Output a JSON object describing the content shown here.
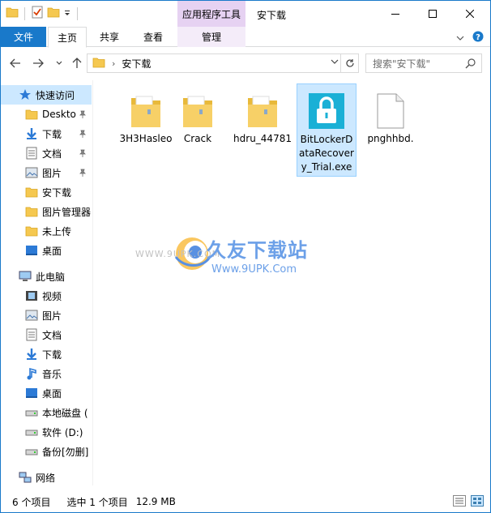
{
  "titlebar": {
    "context_tab": "应用程序工具",
    "title": "安下载",
    "minimize": "—",
    "maximize": "☐",
    "close": "✕"
  },
  "ribbon": {
    "tabs": [
      {
        "label": "文件"
      },
      {
        "label": "主页"
      },
      {
        "label": "共享"
      },
      {
        "label": "查看"
      },
      {
        "label": "管理"
      }
    ]
  },
  "address": {
    "path": "安下载",
    "search_placeholder": "搜索\"安下载\""
  },
  "nav": {
    "items": [
      {
        "label": "快速访问",
        "icon": "star-icon",
        "pinned": false
      },
      {
        "label": "Deskto",
        "icon": "folder-icon",
        "pinned": true
      },
      {
        "label": "下载",
        "icon": "download-icon",
        "pinned": true
      },
      {
        "label": "文档",
        "icon": "document-icon",
        "pinned": true
      },
      {
        "label": "图片",
        "icon": "picture-icon",
        "pinned": true
      },
      {
        "label": "安下载",
        "icon": "folder-icon",
        "pinned": false
      },
      {
        "label": "图片管理器",
        "icon": "folder-icon",
        "pinned": false
      },
      {
        "label": "未上传",
        "icon": "folder-icon",
        "pinned": false
      },
      {
        "label": "桌面",
        "icon": "desktop-icon",
        "pinned": false
      },
      {
        "label": "此电脑",
        "icon": "computer-icon",
        "pinned": false
      },
      {
        "label": "视频",
        "icon": "video-icon",
        "pinned": false
      },
      {
        "label": "图片",
        "icon": "picture-icon",
        "pinned": false
      },
      {
        "label": "文档",
        "icon": "document-icon",
        "pinned": false
      },
      {
        "label": "下载",
        "icon": "download-icon",
        "pinned": false
      },
      {
        "label": "音乐",
        "icon": "music-icon",
        "pinned": false
      },
      {
        "label": "桌面",
        "icon": "desktop-icon",
        "pinned": false
      },
      {
        "label": "本地磁盘 (",
        "icon": "drive-icon",
        "pinned": false
      },
      {
        "label": "软件 (D:)",
        "icon": "drive-icon",
        "pinned": false
      },
      {
        "label": "备份[勿删]",
        "icon": "drive-icon",
        "pinned": false
      },
      {
        "label": "网络",
        "icon": "network-icon",
        "pinned": false
      }
    ]
  },
  "files": [
    {
      "name": "3H3Hasleo",
      "type": "folder"
    },
    {
      "name": "Crack",
      "type": "folder"
    },
    {
      "name": "hdru_44781",
      "type": "folder"
    },
    {
      "name": "BitLockerDataRecovery_Trial.exe",
      "type": "app"
    },
    {
      "name": "pnghhbd.",
      "type": "file"
    }
  ],
  "watermark": {
    "title": "久友下载站",
    "url": "Www.9UPK.Com",
    "url_left": "WWW.9UPK.COM"
  },
  "status": {
    "count": "6 个项目",
    "selected": "选中 1 个项目",
    "size": "12.9 MB"
  },
  "colors": {
    "accent": "#1979ca",
    "selection": "#cce8ff",
    "context_tab": "#e6d2f2",
    "folder": "#f5c850"
  }
}
